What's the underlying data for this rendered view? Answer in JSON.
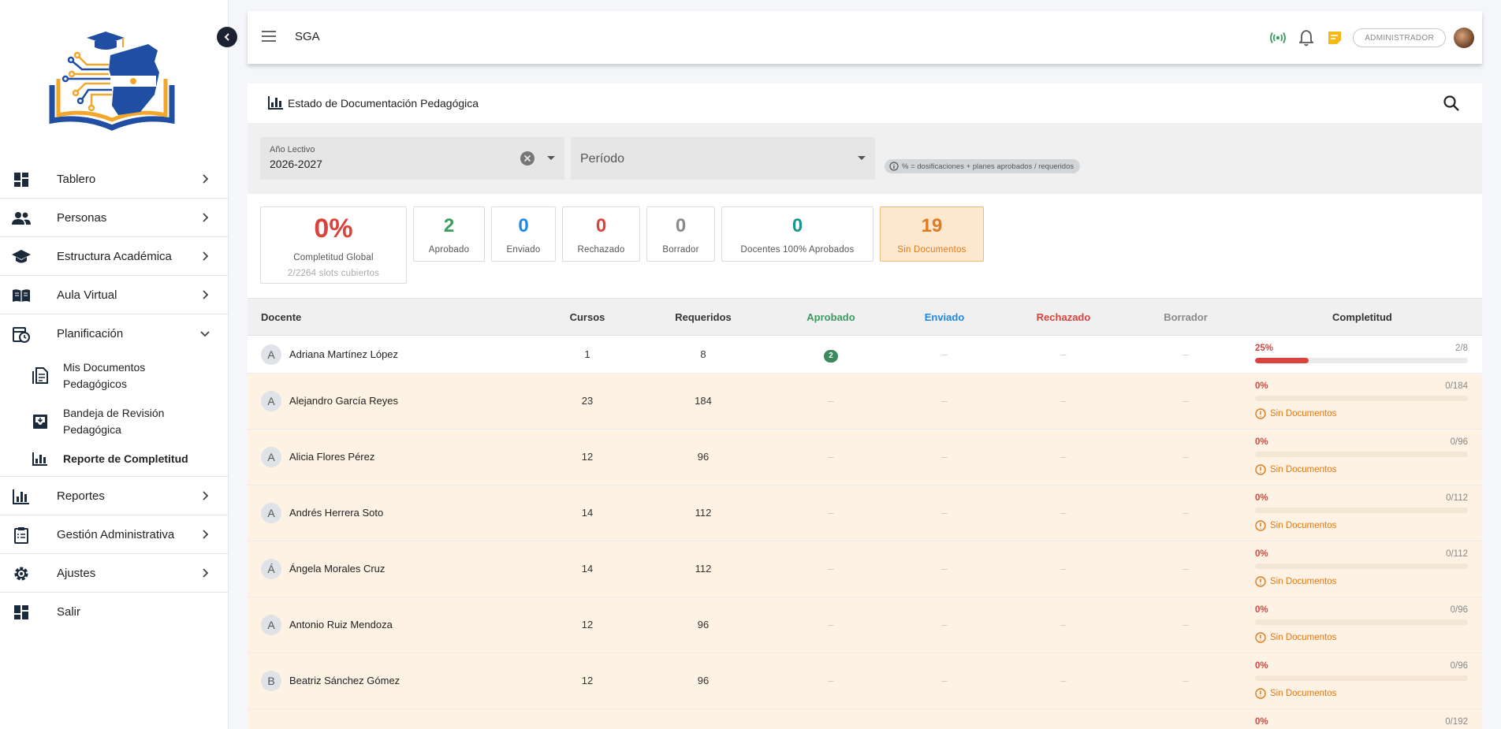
{
  "app": {
    "title": "SGA",
    "role": "ADMINISTRADOR"
  },
  "colors": {
    "primary": "#1f4ea3",
    "gold": "#f2a62b",
    "green": "#3a9d5d",
    "blue": "#1e88e5",
    "red": "#d9433b",
    "grey": "#8a8a8a",
    "teal": "#17968a",
    "orange": "#e07a1f"
  },
  "sidebar": {
    "items": [
      {
        "label": "Tablero",
        "icon": "dashboard-icon"
      },
      {
        "label": "Personas",
        "icon": "people-icon"
      },
      {
        "label": "Estructura Académica",
        "icon": "school-icon"
      },
      {
        "label": "Aula Virtual",
        "icon": "book-icon"
      },
      {
        "label": "Planificación",
        "icon": "calendar-clock-icon"
      },
      {
        "label": "Reportes",
        "icon": "bar-chart-icon"
      },
      {
        "label": "Gestión Administrativa",
        "icon": "clipboard-icon"
      },
      {
        "label": "Ajustes",
        "icon": "gear-icon"
      },
      {
        "label": "Salir",
        "icon": "dashboard-icon"
      }
    ],
    "planning_sub": [
      {
        "label": "Mis Documentos Pedagógicos",
        "icon": "document-icon"
      },
      {
        "label": "Bandeja de Revisión Pedagógica",
        "icon": "inbox-icon"
      },
      {
        "label": "Reporte de Completitud",
        "icon": "bar-chart-icon"
      }
    ]
  },
  "page": {
    "title": "Estado de Documentación Pedagógica",
    "filters": {
      "year_label": "Año Lectivo",
      "year_value": "2026-2027",
      "period_placeholder": "Período",
      "info": "% = dosificaciones + planes aprobados / requeridos"
    },
    "stats": {
      "global_value": "0%",
      "global_label": "Completitud Global",
      "global_sub": "2/2264 slots cubiertos",
      "approved_value": "2",
      "approved_label": "Aprobado",
      "sent_value": "0",
      "sent_label": "Enviado",
      "rejected_value": "0",
      "rejected_label": "Rechazado",
      "draft_value": "0",
      "draft_label": "Borrador",
      "full_value": "0",
      "full_label": "Docentes 100% Aprobados",
      "nodocs_value": "19",
      "nodocs_label": "Sin Documentos"
    },
    "table": {
      "headers": {
        "docente": "Docente",
        "cursos": "Cursos",
        "requeridos": "Requeridos",
        "aprobado": "Aprobado",
        "enviado": "Enviado",
        "rechazado": "Rechazado",
        "borrador": "Borrador",
        "completitud": "Completitud"
      },
      "dash": "–",
      "no_docs": "Sin Documentos",
      "rows": [
        {
          "initial": "A",
          "name": "Adriana Martínez López",
          "cursos": "1",
          "requeridos": "8",
          "aprobado": "2",
          "pct": "25%",
          "progress": 0.25,
          "ratio": "2/8"
        },
        {
          "initial": "A",
          "name": "Alejandro García Reyes",
          "cursos": "23",
          "requeridos": "184",
          "pct": "0%",
          "progress": 0,
          "ratio": "0/184"
        },
        {
          "initial": "A",
          "name": "Alicia Flores Pérez",
          "cursos": "12",
          "requeridos": "96",
          "pct": "0%",
          "progress": 0,
          "ratio": "0/96"
        },
        {
          "initial": "A",
          "name": "Andrés Herrera Soto",
          "cursos": "14",
          "requeridos": "112",
          "pct": "0%",
          "progress": 0,
          "ratio": "0/112"
        },
        {
          "initial": "Á",
          "name": "Ángela Morales Cruz",
          "cursos": "14",
          "requeridos": "112",
          "pct": "0%",
          "progress": 0,
          "ratio": "0/112"
        },
        {
          "initial": "A",
          "name": "Antonio Ruiz Mendoza",
          "cursos": "12",
          "requeridos": "96",
          "pct": "0%",
          "progress": 0,
          "ratio": "0/96"
        },
        {
          "initial": "B",
          "name": "Beatriz Sánchez Gómez",
          "cursos": "12",
          "requeridos": "96",
          "pct": "0%",
          "progress": 0,
          "ratio": "0/96"
        },
        {
          "pct": "0%",
          "progress": 0,
          "ratio": "0/192"
        }
      ]
    }
  }
}
